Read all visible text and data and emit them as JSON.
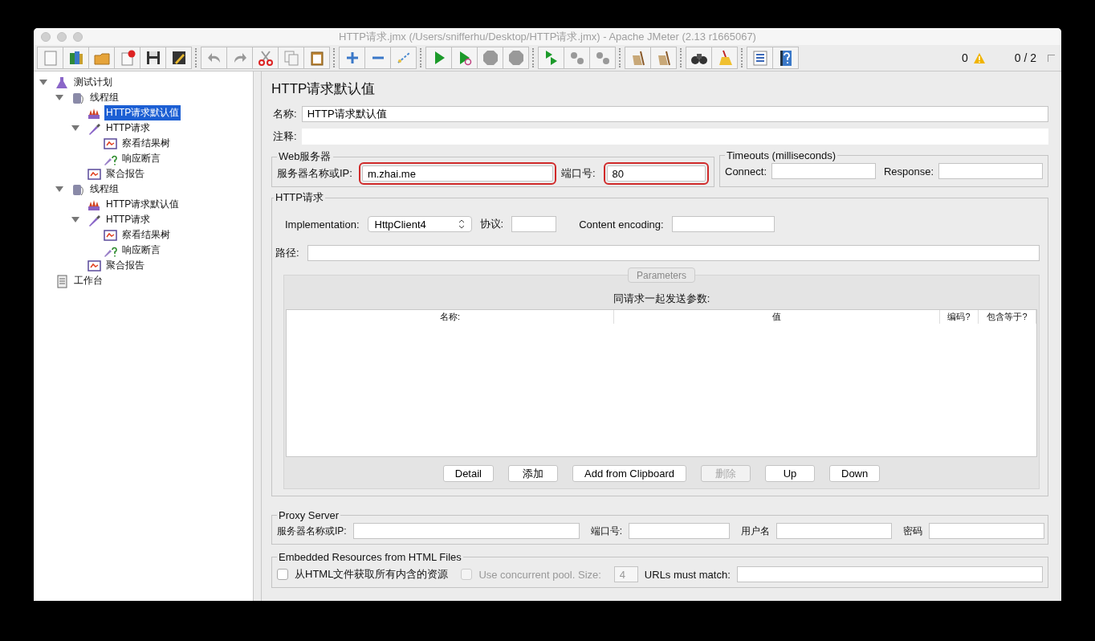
{
  "window": {
    "title": "HTTP请求.jmx (/Users/snifferhu/Desktop/HTTP请求.jmx) - Apache JMeter (2.13 r1665067)"
  },
  "toolbar": {
    "error_count": "0",
    "thread_count": "0 / 2"
  },
  "tree": [
    {
      "label": "测试计划",
      "kind": "plan",
      "selected": false,
      "expanded": true,
      "children": [
        {
          "label": "线程组",
          "kind": "threadgroup",
          "selected": false,
          "expanded": true,
          "children": [
            {
              "label": "HTTP请求默认值",
              "kind": "config",
              "selected": true
            },
            {
              "label": "HTTP请求",
              "kind": "sampler",
              "selected": false,
              "expanded": true,
              "children": [
                {
                  "label": "察看结果树",
                  "kind": "listener",
                  "selected": false
                },
                {
                  "label": "响应断言",
                  "kind": "assertion",
                  "selected": false
                }
              ]
            },
            {
              "label": "聚合报告",
              "kind": "listener",
              "selected": false
            }
          ]
        },
        {
          "label": "线程组",
          "kind": "threadgroup",
          "selected": false,
          "expanded": true,
          "children": [
            {
              "label": "HTTP请求默认值",
              "kind": "config",
              "selected": false
            },
            {
              "label": "HTTP请求",
              "kind": "sampler",
              "selected": false,
              "expanded": true,
              "children": [
                {
                  "label": "察看结果树",
                  "kind": "listener",
                  "selected": false
                },
                {
                  "label": "响应断言",
                  "kind": "assertion",
                  "selected": false
                }
              ]
            },
            {
              "label": "聚合报告",
              "kind": "listener",
              "selected": false
            }
          ]
        }
      ]
    },
    {
      "label": "工作台",
      "kind": "workbench",
      "selected": false
    }
  ],
  "panel": {
    "title": "HTTP请求默认值",
    "name": {
      "label": "名称:",
      "value": "HTTP请求默认值"
    },
    "comment": {
      "label": "注释:"
    },
    "web_server": {
      "legend": "Web服务器",
      "server": {
        "label": "服务器名称或IP:",
        "value": "m.zhai.me",
        "highlighted": true
      },
      "port": {
        "label": "端口号:",
        "value": "80",
        "highlighted": true
      }
    },
    "timeouts": {
      "legend": "Timeouts (milliseconds)",
      "connect": {
        "label": "Connect:"
      },
      "response": {
        "label": "Response:"
      }
    },
    "http_request": {
      "legend": "HTTP请求",
      "implementation": {
        "label": "Implementation:",
        "value": "HttpClient4"
      },
      "protocol": {
        "label": "协议:"
      },
      "encoding": {
        "label": "Content encoding:"
      },
      "path": {
        "label": "路径:"
      },
      "parameters_tab": "Parameters",
      "parameters": {
        "caption": "同请求一起发送参数:",
        "columns": [
          "名称:",
          "值",
          "编码?",
          "包含等于?"
        ],
        "buttons": [
          {
            "label": "Detail",
            "disabled": false
          },
          {
            "label": "添加",
            "disabled": false
          },
          {
            "label": "Add from Clipboard",
            "disabled": false
          },
          {
            "label": "删除",
            "disabled": true
          },
          {
            "label": "Up",
            "disabled": false
          },
          {
            "label": "Down",
            "disabled": false
          }
        ]
      }
    },
    "proxy": {
      "legend": "Proxy Server",
      "fields": [
        {
          "label": "服务器名称或IP:"
        },
        {
          "label": "端口号:"
        },
        {
          "label": "用户名"
        },
        {
          "label": "密码"
        }
      ]
    },
    "embedded": {
      "legend": "Embedded Resources from HTML Files",
      "retrieve": {
        "label": "从HTML文件获取所有内含的资源",
        "checked": false,
        "disabled": false
      },
      "concurrent": {
        "label": "Use concurrent pool. Size:",
        "checked": false,
        "disabled": true
      },
      "pool_size": {
        "value": "4",
        "disabled": true
      },
      "urls_match": {
        "label": "URLs must match:"
      }
    }
  }
}
